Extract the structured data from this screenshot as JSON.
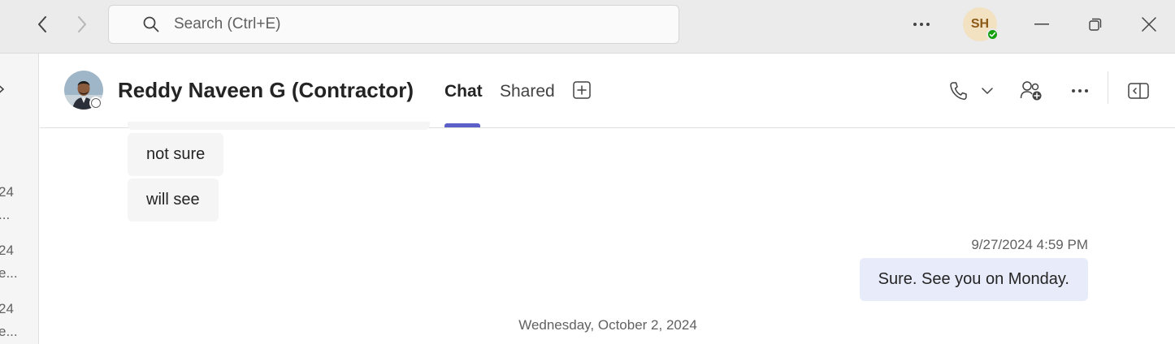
{
  "titlebar": {
    "search_placeholder": "Search (Ctrl+E)",
    "user_initials": "SH"
  },
  "left_rail": {
    "items": [
      {
        "line1": "24",
        "line2": "..."
      },
      {
        "line1": "24",
        "line2": "e..."
      },
      {
        "line1": "24",
        "line2": "e..."
      }
    ]
  },
  "chat_header": {
    "contact_name": "Reddy Naveen G (Contractor)",
    "tabs": [
      {
        "label": "Chat",
        "active": true
      },
      {
        "label": "Shared",
        "active": false
      }
    ]
  },
  "messages": {
    "incoming": [
      "not sure",
      "will see"
    ],
    "outgoing": {
      "timestamp": "9/27/2024 4:59 PM",
      "text": "Sure. See you on Monday."
    },
    "date_separator": "Wednesday, October 2, 2024"
  },
  "colors": {
    "accent": "#5b5fc7",
    "presence_available": "#13a10e",
    "outgoing_bubble": "#e8ebfa",
    "incoming_bubble": "#f5f5f5"
  }
}
